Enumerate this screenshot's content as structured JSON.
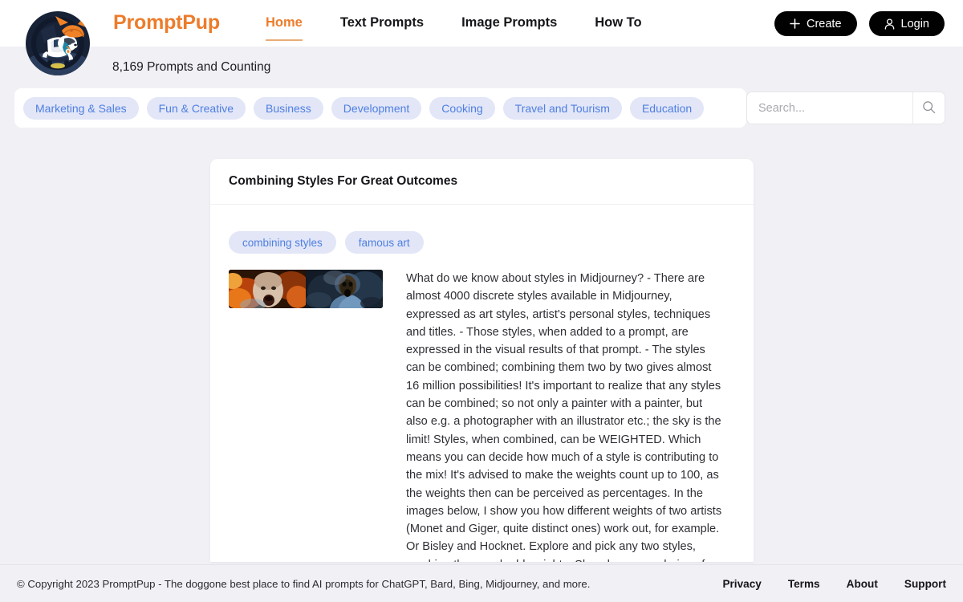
{
  "brand": {
    "name": "PromptPup",
    "logo_icon": "dog-skateboard-logo",
    "accent_color": "#ec7c2b"
  },
  "nav": {
    "items": [
      {
        "label": "Home",
        "active": true
      },
      {
        "label": "Text Prompts",
        "active": false
      },
      {
        "label": "Image Prompts",
        "active": false
      },
      {
        "label": "How To",
        "active": false
      }
    ]
  },
  "header_actions": {
    "create": {
      "label": "Create",
      "icon": "plus-icon"
    },
    "login": {
      "label": "Login",
      "icon": "user-icon"
    }
  },
  "subheader": {
    "prompt_count_text": "8,169 Prompts and Counting"
  },
  "categories": {
    "chips": [
      "Marketing & Sales",
      "Fun & Creative",
      "Business",
      "Development",
      "Cooking",
      "Travel and Tourism",
      "Education"
    ],
    "chip_bg_color": "#e2e6f7",
    "chip_text_color": "#4f7fe0"
  },
  "search": {
    "value": "",
    "placeholder": "Search...",
    "icon": "search-icon"
  },
  "card": {
    "title": "Combining Styles For Great Outcomes",
    "tags": [
      "combining styles",
      "famous art"
    ],
    "thumbnail_alt": "two-panel-screaming-face-artwork",
    "body": "What do we know about styles in Midjourney? - There are almost 4000 discrete styles available in Midjourney, expressed as art styles, artist's personal styles, techniques and titles. - Those styles, when added to a prompt, are expressed in the visual results of that prompt. - The styles can be combined; combining them two by two gives almost 16 million possibilities! It's important to realize that any styles can be combined; so not only a painter with a painter, but also e.g. a photographer with an illustrator etc.; the sky is the limit! Styles, when combined, can be WEIGHTED. Which means you can decide how much of a style is contributing to the mix! It's advised to make the weights count up to 100, as the weights then can be perceived as percentages. In the images below, I show you how different weights of two artists (Monet and Giger, quite distinct ones) work out, for example. Or Bisley and Hocknet. Explore and pick any two styles, combine them and add weights. Show how your choice of"
  },
  "footer": {
    "copyright": "© Copyright 2023 PromptPup - The doggone best place to find AI prompts for ChatGPT, Bard, Bing, Midjourney, and more.",
    "links": [
      "Privacy",
      "Terms",
      "About",
      "Support"
    ]
  }
}
